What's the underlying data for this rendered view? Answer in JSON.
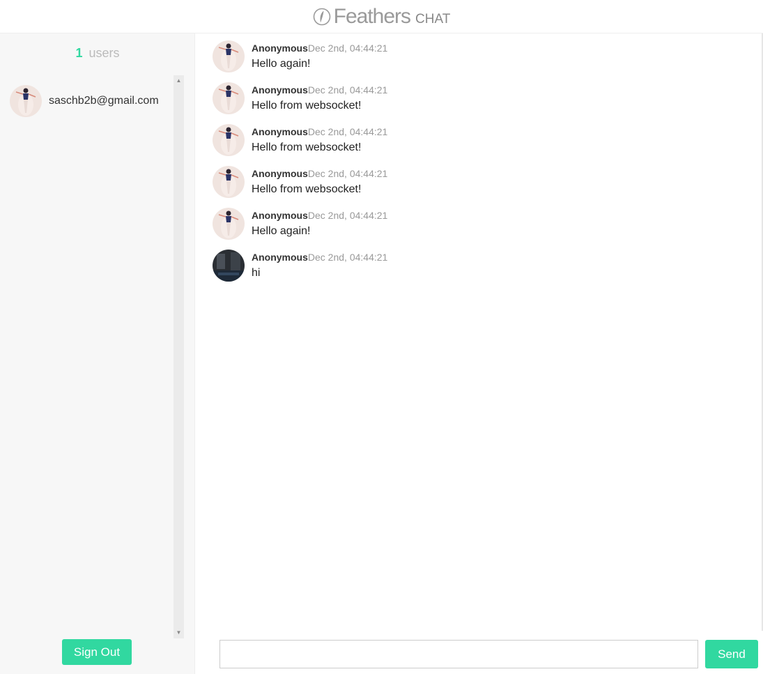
{
  "header": {
    "logo_text": "Feathers",
    "logo_sub": "CHAT"
  },
  "sidebar": {
    "user_count": "1",
    "user_count_label": "users",
    "users": [
      {
        "email": "saschb2b@gmail.com",
        "avatar": "photo-woman-icon"
      }
    ],
    "signout_label": "Sign Out"
  },
  "messages": [
    {
      "author": "Anonymous",
      "time": "Dec 2nd, 04:44:21",
      "text": "Hello again!",
      "avatar": "photo-woman-icon"
    },
    {
      "author": "Anonymous",
      "time": "Dec 2nd, 04:44:21",
      "text": "Hello from websocket!",
      "avatar": "photo-woman-icon"
    },
    {
      "author": "Anonymous",
      "time": "Dec 2nd, 04:44:21",
      "text": "Hello from websocket!",
      "avatar": "photo-woman-icon"
    },
    {
      "author": "Anonymous",
      "time": "Dec 2nd, 04:44:21",
      "text": "Hello from websocket!",
      "avatar": "photo-woman-icon"
    },
    {
      "author": "Anonymous",
      "time": "Dec 2nd, 04:44:21",
      "text": "Hello again!",
      "avatar": "photo-woman-icon"
    },
    {
      "author": "Anonymous",
      "time": "Dec 2nd, 04:44:21",
      "text": "hi",
      "avatar": "photo-dark-room-icon"
    }
  ],
  "compose": {
    "value": "",
    "placeholder": "",
    "send_label": "Send"
  },
  "colors": {
    "accent": "#31d8a0",
    "sidebar_bg": "#f7f7f7",
    "muted_text": "#999999"
  }
}
